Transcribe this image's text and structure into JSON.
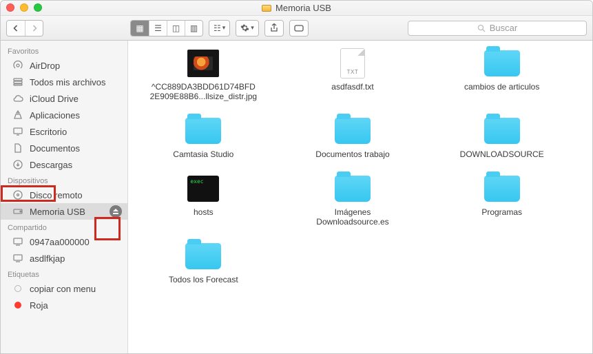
{
  "window": {
    "title": "Memoria USB"
  },
  "toolbar": {
    "search_placeholder": "Buscar"
  },
  "sidebar": {
    "sections": {
      "favoritos": {
        "label": "Favoritos",
        "items": [
          {
            "label": "AirDrop"
          },
          {
            "label": "Todos mis archivos"
          },
          {
            "label": "iCloud Drive"
          },
          {
            "label": "Aplicaciones"
          },
          {
            "label": "Escritorio"
          },
          {
            "label": "Documentos"
          },
          {
            "label": "Descargas"
          }
        ]
      },
      "dispositivos": {
        "label": "Dispositivos",
        "items": [
          {
            "label": "Disco remoto"
          },
          {
            "label": "Memoria USB"
          }
        ]
      },
      "compartido": {
        "label": "Compartido",
        "items": [
          {
            "label": "0947aa000000"
          },
          {
            "label": "asdlfkjap"
          }
        ]
      },
      "etiquetas": {
        "label": "Etiquetas",
        "items": [
          {
            "label": "copiar con menu"
          },
          {
            "label": "Roja"
          }
        ]
      }
    }
  },
  "files": [
    {
      "name_line1": "^CC889DA3BDD61D74BFD",
      "name_line2": "2E909E88B6...llsize_distr.jpg",
      "kind": "image"
    },
    {
      "name_line1": "asdfasdf.txt",
      "name_line2": "",
      "kind": "txt",
      "badge": "TXT"
    },
    {
      "name_line1": "cambios de articulos",
      "name_line2": "",
      "kind": "folder"
    },
    {
      "name_line1": "Camtasia Studio",
      "name_line2": "",
      "kind": "folder"
    },
    {
      "name_line1": "Documentos trabajo",
      "name_line2": "",
      "kind": "folder"
    },
    {
      "name_line1": "DOWNLOADSOURCE",
      "name_line2": "",
      "kind": "folder"
    },
    {
      "name_line1": "hosts",
      "name_line2": "",
      "kind": "exec",
      "exec_text": "exec"
    },
    {
      "name_line1": "Imágenes",
      "name_line2": "Downloadsource.es",
      "kind": "folder"
    },
    {
      "name_line1": "Programas",
      "name_line2": "",
      "kind": "folder"
    },
    {
      "name_line1": "Todos los Forecast",
      "name_line2": "",
      "kind": "folder"
    }
  ]
}
